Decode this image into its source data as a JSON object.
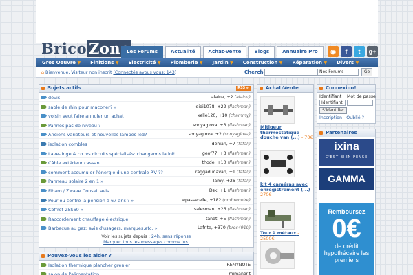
{
  "brand": {
    "logo_left": "Brico",
    "logo_right": "Zone"
  },
  "nav": {
    "tabs": [
      "Les Forums",
      "Actualité",
      "Achat-Vente",
      "Blogs",
      "Annuaire Pro"
    ]
  },
  "social": [
    {
      "icon": "rss-icon",
      "glyph": "◉",
      "color": "#f08a24"
    },
    {
      "icon": "facebook-icon",
      "glyph": "f",
      "color": "#3b5998"
    },
    {
      "icon": "twitter-icon",
      "glyph": "t",
      "color": "#3aa8e0"
    },
    {
      "icon": "googleplus-icon",
      "glyph": "g+",
      "color": "#5a6470"
    }
  ],
  "categories": [
    "Gros Oeuvre",
    "Finitions",
    "Electricité",
    "Plomberie",
    "Jardin",
    "Construction",
    "Réparation",
    "Divers"
  ],
  "welcome": {
    "text": "Bienvenue, Visiteur non inscrit",
    "connected": "(Connectés avous vous: 143",
    "suffix": ")"
  },
  "search": {
    "label": "Chercher:",
    "scope": "Nos Forums",
    "go": "Go"
  },
  "sujets": {
    "title": "Sujets actifs",
    "rss": "RSS ⊕",
    "rows": [
      {
        "title": "devis",
        "right": "alainv, +2 ",
        "user": "(alainv)"
      },
      {
        "title": "sable de rhin pour maconer?  »",
        "right": "didi1078, +22 ",
        "user": "(flashman)"
      },
      {
        "title": "voisin veut faire annuler un achat",
        "right": "xelle120, +10 ",
        "user": "(chammy)"
      },
      {
        "title": "Pannes pas de niveau ?",
        "right": "sonyagiova, +3 ",
        "user": "(flashman)"
      },
      {
        "title": "Anciens variateurs et nouvelles lampes led?",
        "right": "sonyagiova, +2 ",
        "user": "(sonyagiova)"
      },
      {
        "title": "isolation combles",
        "right": "dehian, +7 ",
        "user": "(fafali)"
      },
      {
        "title": "Lave-linge & co. vs circuits spécialisés: changeons la loi!",
        "right": "geof77, +3 ",
        "user": "(flashman)"
      },
      {
        "title": "Câble extérieur cassant",
        "right": "thode, +10 ",
        "user": "(flashman)"
      },
      {
        "title": "comment accumuler l'énergie d'une centrale P.V ??",
        "right": "raggadudavan, +1 ",
        "user": "(fafali)"
      },
      {
        "title": "Panneau solaire 2 en 1  »",
        "right": "lamy, +26 ",
        "user": "(fafali)"
      },
      {
        "title": "Fibaro / Zwave Conseil avis",
        "right": "Dsk, +1 ",
        "user": "(flashman)"
      },
      {
        "title": "Pour ou contre la pension à 67 ans ?  »",
        "right": "lepasserelle, +182 ",
        "user": "(ombrenoire)"
      },
      {
        "title": "Coffret 25S60  »",
        "right": "salesman, +26 ",
        "user": "(flashman)"
      },
      {
        "title": "Raccordement chauffage électrique",
        "right": "tandt, +5 ",
        "user": "(flashman)"
      },
      {
        "title": "Barbecue au gaz: avis d'usagers, marques,etc.  »",
        "right": "Lafrite, +370 ",
        "user": "(broc4910)"
      }
    ],
    "footer1": "Voir les sujets depuis : ",
    "footer_link1": "24h",
    "footer_sep": ", ",
    "footer_link2": "sans réponse",
    "footer2": "Marquer tous les messages comme lus."
  },
  "aider": {
    "title": "Pouvez-vous les aider ?",
    "rows": [
      {
        "title": "Isolation thermique plancher grenier",
        "right": "REMYNOTE"
      },
      {
        "title": "salon de l'alimentation",
        "right": "mimanont"
      }
    ]
  },
  "achat": {
    "title": "Achat-Vente",
    "items": [
      {
        "title": "Mitigeur thermostatique douche van (...)",
        "sep": " - ",
        "price": "70€"
      },
      {
        "title": "kit 4 caméras avec enregistrement (...)",
        "sep": " - ",
        "price": "270€"
      },
      {
        "title": "Tour à métaux",
        "sep": " - ",
        "price": "2500€"
      }
    ]
  },
  "connexion": {
    "title": "Connexion!",
    "id_label": "Identifiant",
    "pw_label": "Mot de passe",
    "id_value": "Identifiant",
    "submit": "S'identifier",
    "inscription": "Inscription",
    "sep": " - ",
    "oublie": "Oublié ?"
  },
  "partners": {
    "title": "Partenaires",
    "ixina": "ixina",
    "ixina_tag": "C'EST BIEN PENSÉ",
    "gamma": "GAMMA",
    "credit_l1": "Remboursez",
    "credit_l2": "0€",
    "credit_l3": "de crédit hypothécaire les premiers"
  }
}
